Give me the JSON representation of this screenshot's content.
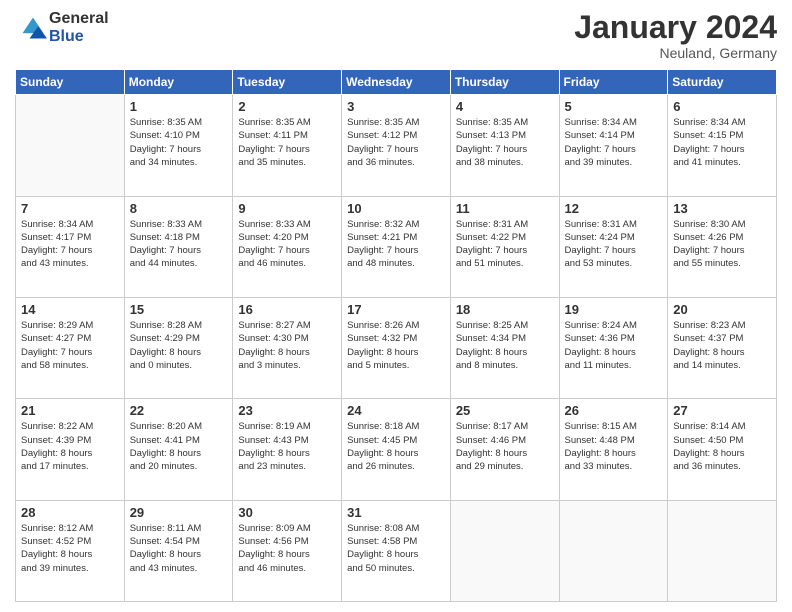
{
  "logo": {
    "general": "General",
    "blue": "Blue"
  },
  "title": "January 2024",
  "subtitle": "Neuland, Germany",
  "days_header": [
    "Sunday",
    "Monday",
    "Tuesday",
    "Wednesday",
    "Thursday",
    "Friday",
    "Saturday"
  ],
  "weeks": [
    [
      {
        "day": "",
        "info": ""
      },
      {
        "day": "1",
        "info": "Sunrise: 8:35 AM\nSunset: 4:10 PM\nDaylight: 7 hours\nand 34 minutes."
      },
      {
        "day": "2",
        "info": "Sunrise: 8:35 AM\nSunset: 4:11 PM\nDaylight: 7 hours\nand 35 minutes."
      },
      {
        "day": "3",
        "info": "Sunrise: 8:35 AM\nSunset: 4:12 PM\nDaylight: 7 hours\nand 36 minutes."
      },
      {
        "day": "4",
        "info": "Sunrise: 8:35 AM\nSunset: 4:13 PM\nDaylight: 7 hours\nand 38 minutes."
      },
      {
        "day": "5",
        "info": "Sunrise: 8:34 AM\nSunset: 4:14 PM\nDaylight: 7 hours\nand 39 minutes."
      },
      {
        "day": "6",
        "info": "Sunrise: 8:34 AM\nSunset: 4:15 PM\nDaylight: 7 hours\nand 41 minutes."
      }
    ],
    [
      {
        "day": "7",
        "info": "Sunrise: 8:34 AM\nSunset: 4:17 PM\nDaylight: 7 hours\nand 43 minutes."
      },
      {
        "day": "8",
        "info": "Sunrise: 8:33 AM\nSunset: 4:18 PM\nDaylight: 7 hours\nand 44 minutes."
      },
      {
        "day": "9",
        "info": "Sunrise: 8:33 AM\nSunset: 4:20 PM\nDaylight: 7 hours\nand 46 minutes."
      },
      {
        "day": "10",
        "info": "Sunrise: 8:32 AM\nSunset: 4:21 PM\nDaylight: 7 hours\nand 48 minutes."
      },
      {
        "day": "11",
        "info": "Sunrise: 8:31 AM\nSunset: 4:22 PM\nDaylight: 7 hours\nand 51 minutes."
      },
      {
        "day": "12",
        "info": "Sunrise: 8:31 AM\nSunset: 4:24 PM\nDaylight: 7 hours\nand 53 minutes."
      },
      {
        "day": "13",
        "info": "Sunrise: 8:30 AM\nSunset: 4:26 PM\nDaylight: 7 hours\nand 55 minutes."
      }
    ],
    [
      {
        "day": "14",
        "info": "Sunrise: 8:29 AM\nSunset: 4:27 PM\nDaylight: 7 hours\nand 58 minutes."
      },
      {
        "day": "15",
        "info": "Sunrise: 8:28 AM\nSunset: 4:29 PM\nDaylight: 8 hours\nand 0 minutes."
      },
      {
        "day": "16",
        "info": "Sunrise: 8:27 AM\nSunset: 4:30 PM\nDaylight: 8 hours\nand 3 minutes."
      },
      {
        "day": "17",
        "info": "Sunrise: 8:26 AM\nSunset: 4:32 PM\nDaylight: 8 hours\nand 5 minutes."
      },
      {
        "day": "18",
        "info": "Sunrise: 8:25 AM\nSunset: 4:34 PM\nDaylight: 8 hours\nand 8 minutes."
      },
      {
        "day": "19",
        "info": "Sunrise: 8:24 AM\nSunset: 4:36 PM\nDaylight: 8 hours\nand 11 minutes."
      },
      {
        "day": "20",
        "info": "Sunrise: 8:23 AM\nSunset: 4:37 PM\nDaylight: 8 hours\nand 14 minutes."
      }
    ],
    [
      {
        "day": "21",
        "info": "Sunrise: 8:22 AM\nSunset: 4:39 PM\nDaylight: 8 hours\nand 17 minutes."
      },
      {
        "day": "22",
        "info": "Sunrise: 8:20 AM\nSunset: 4:41 PM\nDaylight: 8 hours\nand 20 minutes."
      },
      {
        "day": "23",
        "info": "Sunrise: 8:19 AM\nSunset: 4:43 PM\nDaylight: 8 hours\nand 23 minutes."
      },
      {
        "day": "24",
        "info": "Sunrise: 8:18 AM\nSunset: 4:45 PM\nDaylight: 8 hours\nand 26 minutes."
      },
      {
        "day": "25",
        "info": "Sunrise: 8:17 AM\nSunset: 4:46 PM\nDaylight: 8 hours\nand 29 minutes."
      },
      {
        "day": "26",
        "info": "Sunrise: 8:15 AM\nSunset: 4:48 PM\nDaylight: 8 hours\nand 33 minutes."
      },
      {
        "day": "27",
        "info": "Sunrise: 8:14 AM\nSunset: 4:50 PM\nDaylight: 8 hours\nand 36 minutes."
      }
    ],
    [
      {
        "day": "28",
        "info": "Sunrise: 8:12 AM\nSunset: 4:52 PM\nDaylight: 8 hours\nand 39 minutes."
      },
      {
        "day": "29",
        "info": "Sunrise: 8:11 AM\nSunset: 4:54 PM\nDaylight: 8 hours\nand 43 minutes."
      },
      {
        "day": "30",
        "info": "Sunrise: 8:09 AM\nSunset: 4:56 PM\nDaylight: 8 hours\nand 46 minutes."
      },
      {
        "day": "31",
        "info": "Sunrise: 8:08 AM\nSunset: 4:58 PM\nDaylight: 8 hours\nand 50 minutes."
      },
      {
        "day": "",
        "info": ""
      },
      {
        "day": "",
        "info": ""
      },
      {
        "day": "",
        "info": ""
      }
    ]
  ]
}
